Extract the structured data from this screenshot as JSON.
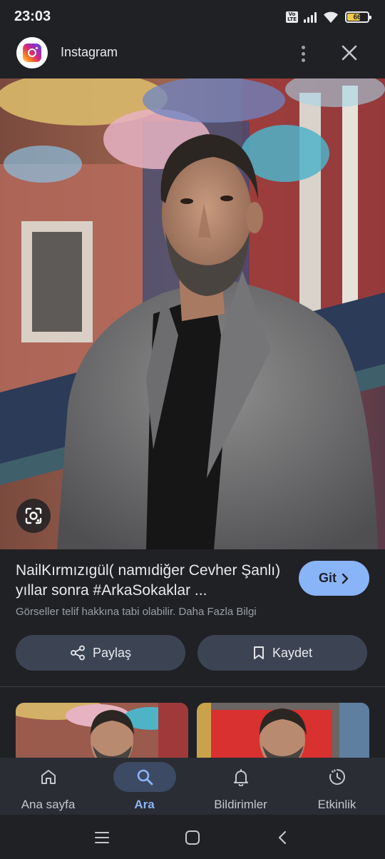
{
  "status_bar": {
    "time": "23:03",
    "volte_label": "Vo\nLTE",
    "battery_level": "66",
    "battery_fraction": 0.66
  },
  "header": {
    "title": "Instagram",
    "logo_icon": "instagram-icon",
    "menu_icon": "more-vert-icon",
    "close_icon": "close-icon"
  },
  "result": {
    "title": "NailKırmızıgül( namıdiğer Cevher Şanlı) yıllar sonra #ArkaSokaklar ...",
    "visit_label": "Git",
    "copyright_text": "Görseller telif hakkına tabi olabilir.",
    "more_info_label": "Daha Fazla Bilgi",
    "share_label": "Paylaş",
    "save_label": "Kaydet"
  },
  "bottom_nav": {
    "items": [
      {
        "label": "Ana sayfa",
        "icon": "home-icon",
        "active": false
      },
      {
        "label": "Ara",
        "icon": "search-icon",
        "active": true
      },
      {
        "label": "Bildirimler",
        "icon": "bell-icon",
        "active": false
      },
      {
        "label": "Etkinlik",
        "icon": "activity-icon",
        "active": false
      }
    ]
  },
  "colors": {
    "background": "#202124",
    "accent": "#8ab4f8",
    "pill": "#3c4454",
    "nav_bg": "#2a2d33"
  }
}
